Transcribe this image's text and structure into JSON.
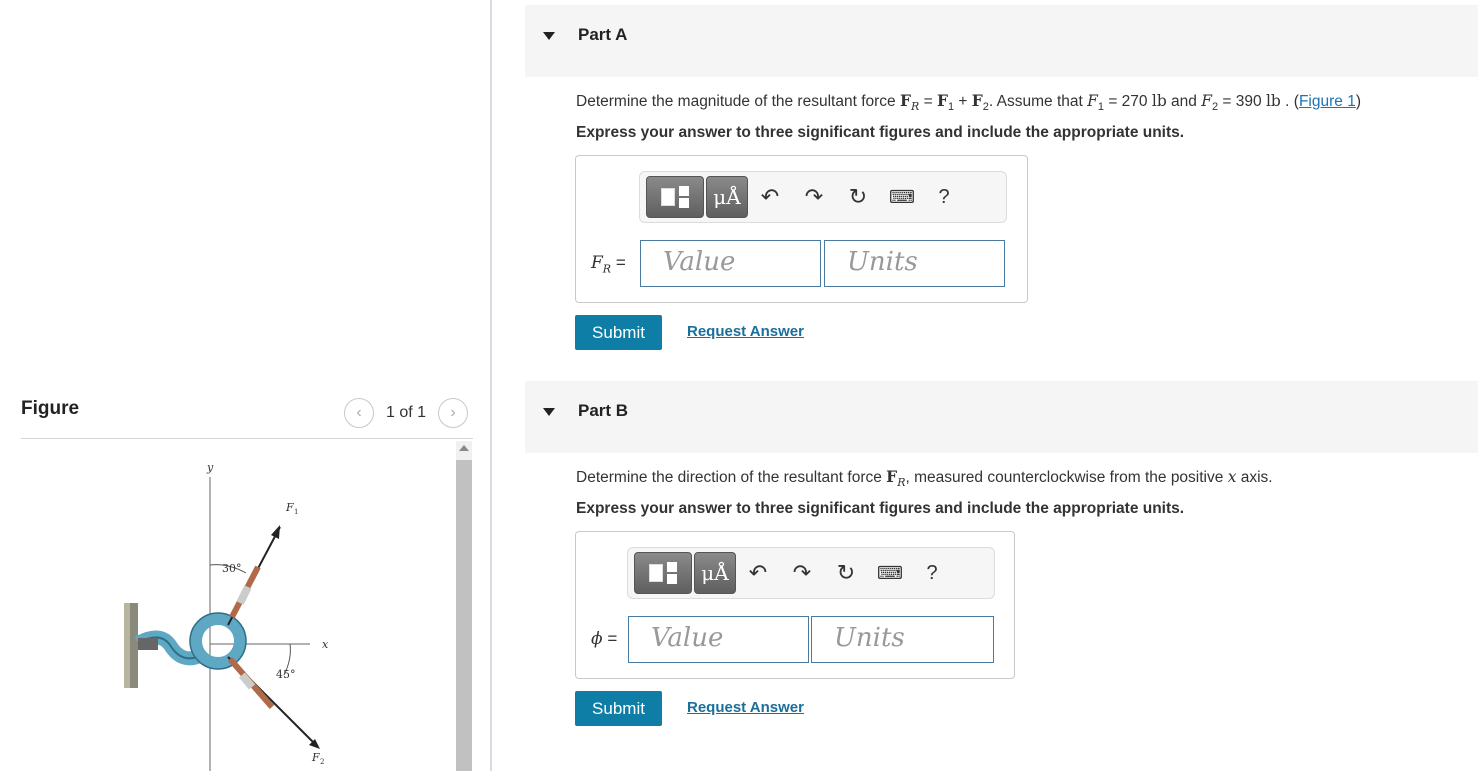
{
  "figure_panel": {
    "title": "Figure",
    "counter": "1 of 1",
    "prev_icon": "chevron-left-icon",
    "next_icon": "chevron-right-icon",
    "labels": {
      "y": "y",
      "x": "x",
      "f1": "F",
      "f1_sub": "1",
      "f2": "F",
      "f2_sub": "2",
      "angle1": "30°",
      "angle2": "45°"
    }
  },
  "part_a": {
    "title": "Part A",
    "q_pre": "Determine the magnitude of the resultant force ",
    "q_fr": "F",
    "q_fr_sub": "R",
    "q_eq": " = ",
    "q_f1": "F",
    "q_f1_sub": "1",
    "q_plus": " + ",
    "q_f2": "F",
    "q_f2_sub": "2",
    "q_mid": ". Assume that ",
    "q_F1": "F",
    "q_F1_sub": "1",
    "q_val1": " = 270 ",
    "q_unit1": "lb",
    "q_and": " and ",
    "q_F2": "F",
    "q_F2_sub": "2",
    "q_val2": " = 390 ",
    "q_unit2": "lb",
    "q_post": " . (",
    "q_link": "Figure 1",
    "q_close": ")",
    "instruction": "Express your answer to three significant figures and include the appropriate units.",
    "label_var": "F",
    "label_sub": "R",
    "label_eq": " =",
    "value_placeholder": "Value",
    "units_placeholder": "Units",
    "submit": "Submit",
    "request": "Request Answer",
    "toolbar": {
      "mu": "μÅ",
      "help": "?",
      "undo_icon": "undo-icon",
      "redo_icon": "redo-icon",
      "reset_icon": "reset-icon",
      "keyboard_icon": "keyboard-icon"
    }
  },
  "part_b": {
    "title": "Part B",
    "q_pre": "Determine the direction of the resultant force ",
    "q_fr": "F",
    "q_fr_sub": "R",
    "q_mid": ", measured counterclockwise from the positive ",
    "q_x": "x",
    "q_post": " axis.",
    "instruction": "Express your answer to three significant figures and include the appropriate units.",
    "label_var": "ϕ",
    "label_eq": " =",
    "value_placeholder": "Value",
    "units_placeholder": "Units",
    "submit": "Submit",
    "request": "Request Answer",
    "toolbar": {
      "mu": "μÅ",
      "help": "?"
    }
  }
}
